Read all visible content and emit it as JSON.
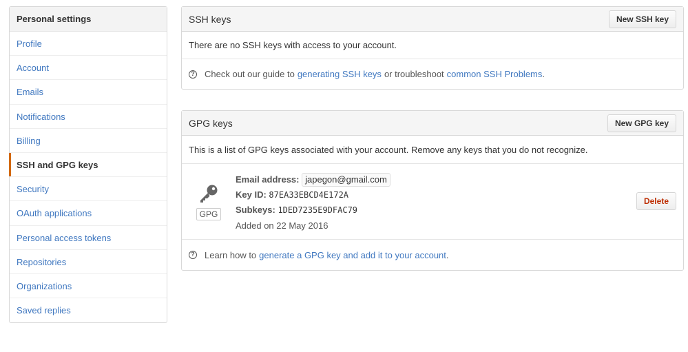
{
  "sidebar": {
    "header": "Personal settings",
    "items": [
      {
        "label": "Profile"
      },
      {
        "label": "Account"
      },
      {
        "label": "Emails"
      },
      {
        "label": "Notifications"
      },
      {
        "label": "Billing"
      },
      {
        "label": "SSH and GPG keys",
        "selected": true
      },
      {
        "label": "Security"
      },
      {
        "label": "OAuth applications"
      },
      {
        "label": "Personal access tokens"
      },
      {
        "label": "Repositories"
      },
      {
        "label": "Organizations"
      },
      {
        "label": "Saved replies"
      }
    ]
  },
  "ssh": {
    "title": "SSH keys",
    "new_button": "New SSH key",
    "empty_message": "There are no SSH keys with access to your account.",
    "help_prefix": "Check out our guide to ",
    "help_link1": "generating SSH keys",
    "help_middle": " or troubleshoot ",
    "help_link2": "common SSH Problems",
    "help_suffix": "."
  },
  "gpg": {
    "title": "GPG keys",
    "new_button": "New GPG key",
    "description": "This is a list of GPG keys associated with your account. Remove any keys that you do not recognize.",
    "key": {
      "badge": "GPG",
      "email_label": "Email address:",
      "email": "japegon@gmail.com",
      "keyid_label": "Key ID:",
      "keyid": "87EA33EBCD4E172A",
      "subkeys_label": "Subkeys:",
      "subkeys": "1DED7235E9DFAC79",
      "added": "Added on 22 May 2016",
      "delete_button": "Delete"
    },
    "help_prefix": "Learn how to ",
    "help_link": "generate a GPG key and add it to your account",
    "help_suffix": "."
  },
  "icons": {
    "help": "question-circle-icon",
    "key": "key-icon"
  },
  "colors": {
    "link": "#4078c0",
    "selected_accent": "#d26911",
    "danger": "#bd2c00"
  }
}
